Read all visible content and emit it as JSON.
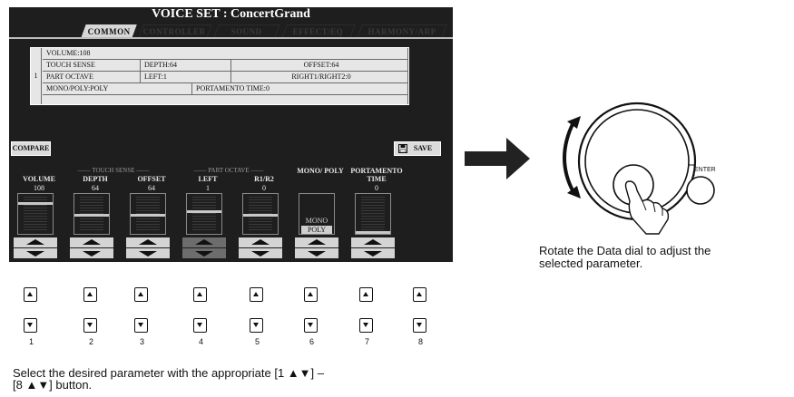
{
  "screen": {
    "title": "VOICE SET : ConcertGrand",
    "tabs": [
      {
        "label": "COMMON",
        "active": true
      },
      {
        "label": "CONTROLLER",
        "active": false
      },
      {
        "label": "SOUND",
        "active": false
      },
      {
        "label": "EFFECT/EQ",
        "active": false
      },
      {
        "label": "HARMONY/ARP",
        "active": false
      }
    ],
    "table": {
      "row_number": "1",
      "volume": "VOLUME:108",
      "touch_sense": "TOUCH SENSE",
      "depth": "DEPTH:64",
      "offset": "OFFSET:64",
      "part_octave": "PART OCTAVE",
      "left": "LEFT:1",
      "right": "RIGHT1/RIGHT2:0",
      "mono_poly": "MONO/POLY:POLY",
      "portamento": "PORTAMENTO TIME:0"
    },
    "compare_label": "COMPARE",
    "save_label": "SAVE",
    "groups": {
      "touch_sense": "TOUCH SENSE",
      "part_octave": "PART OCTAVE"
    },
    "params": [
      {
        "label": "VOLUME",
        "value": "108",
        "level": 0.85
      },
      {
        "label": "DEPTH",
        "value": "64",
        "level": 0.5
      },
      {
        "label": "OFFSET",
        "value": "64",
        "level": 0.5
      },
      {
        "label": "LEFT",
        "value": "1",
        "level": 0.6
      },
      {
        "label": "R1/R2",
        "value": "0",
        "level": 0.5
      },
      {
        "label": "MONO/ POLY",
        "value": "",
        "options": [
          "MONO",
          "POLY"
        ],
        "selected": "POLY"
      },
      {
        "label": "PORTAMENTO TIME",
        "value": "0",
        "level": 0.0
      }
    ]
  },
  "panel": {
    "button_numbers": [
      "1",
      "2",
      "3",
      "4",
      "5",
      "6",
      "7",
      "8"
    ],
    "up_glyph": "▲",
    "down_glyph": "▼",
    "select_caption_line1": "Select the desired parameter with the appropriate [1 ▲▼] –",
    "select_caption_line2": "[8 ▲▼] button."
  },
  "dial": {
    "enter_label": "ENTER",
    "caption_line1": "Rotate the Data dial to adjust the",
    "caption_line2": "selected parameter."
  }
}
